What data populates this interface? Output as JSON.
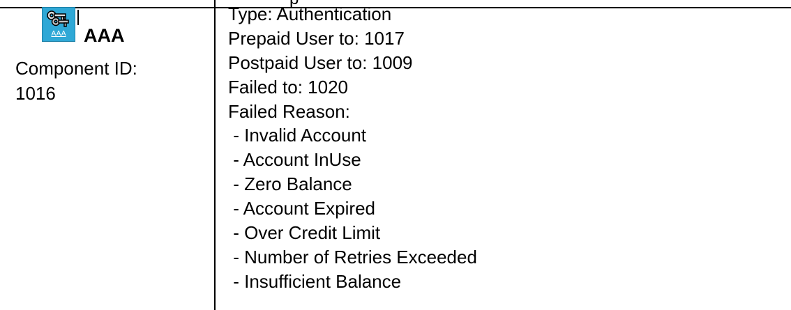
{
  "top_fragment": "p",
  "component": {
    "icon": "keys-icon",
    "icon_label": "AAA",
    "name": "AAA",
    "id_label": "Component ID:",
    "id_value": "1016"
  },
  "details": {
    "type": "Type: Authentication",
    "prepaid": "Prepaid User to: 1017",
    "postpaid": "Postpaid User to: 1009",
    "failed": "Failed to: 1020",
    "reason_header": "Failed Reason:",
    "reasons": [
      " - Invalid Account",
      " - Account InUse",
      " - Zero Balance",
      " - Account Expired",
      " - Over Credit Limit",
      " - Number of Retries Exceeded",
      " - Insufficient Balance"
    ]
  }
}
